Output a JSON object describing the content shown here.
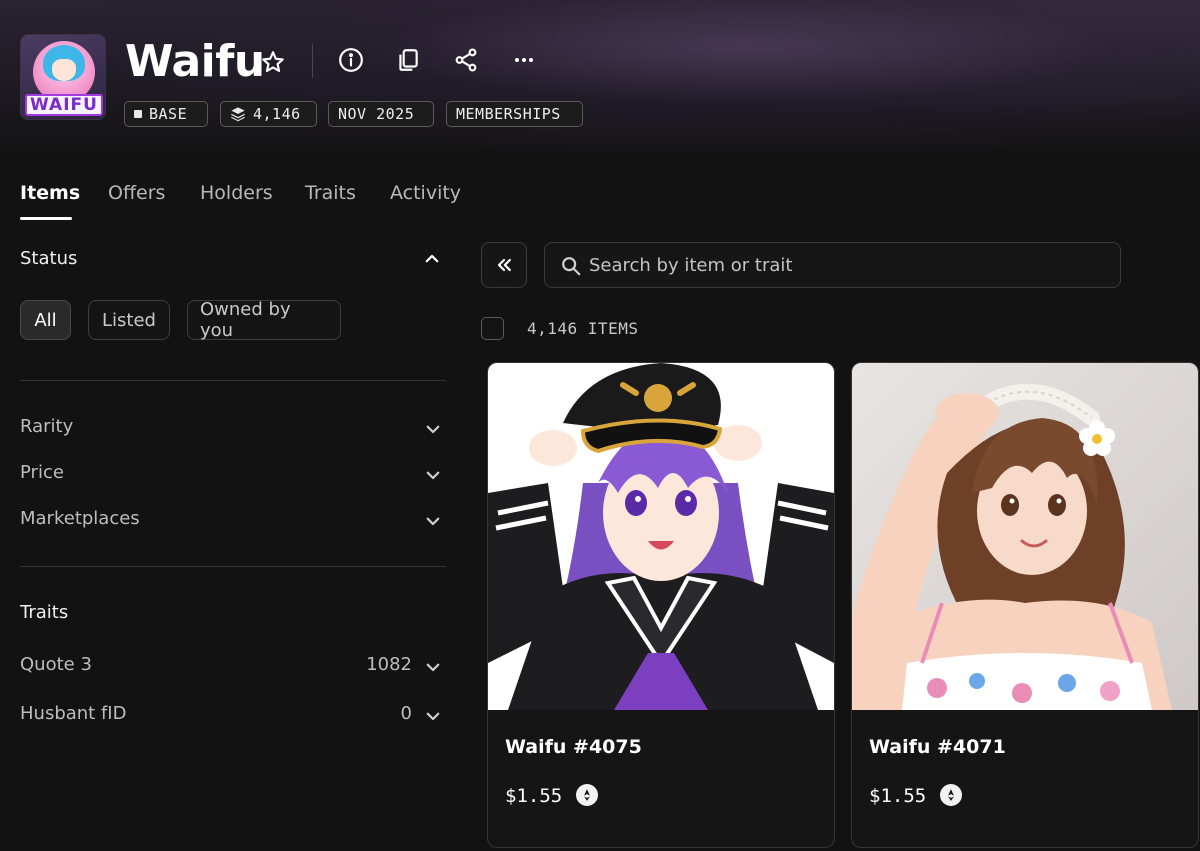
{
  "collection": {
    "name": "Waifu",
    "logo_text": "WAIFU",
    "badges": {
      "chain": "BASE",
      "supply": "4,146",
      "date": "NOV 2025",
      "category": "MEMBERSHIPS"
    }
  },
  "header_actions": [
    "star-icon",
    "info-icon",
    "copy-icon",
    "share-icon",
    "more-icon"
  ],
  "tabs": [
    {
      "label": "Items",
      "active": true
    },
    {
      "label": "Offers",
      "active": false
    },
    {
      "label": "Holders",
      "active": false
    },
    {
      "label": "Traits",
      "active": false
    },
    {
      "label": "Activity",
      "active": false
    }
  ],
  "sidebar": {
    "status": {
      "heading": "Status",
      "options": [
        {
          "label": "All",
          "active": true
        },
        {
          "label": "Listed",
          "active": false
        },
        {
          "label": "Owned by you",
          "active": false
        }
      ]
    },
    "filters": [
      {
        "label": "Rarity"
      },
      {
        "label": "Price"
      },
      {
        "label": "Marketplaces"
      }
    ],
    "traits": {
      "heading": "Traits",
      "items": [
        {
          "label": "Quote 3",
          "count": "1082"
        },
        {
          "label": "Husbant fID",
          "count": "0"
        }
      ]
    }
  },
  "search": {
    "placeholder": "Search by item or trait"
  },
  "items_count_label": "4,146 ITEMS",
  "items": [
    {
      "name": "Waifu #4075",
      "price": "$1.55"
    },
    {
      "name": "Waifu #4071",
      "price": "$1.55"
    }
  ],
  "colors": {
    "background": "#121212",
    "text": "#ffffff",
    "muted": "#bdbdbd",
    "border": "#3a3a3a"
  }
}
